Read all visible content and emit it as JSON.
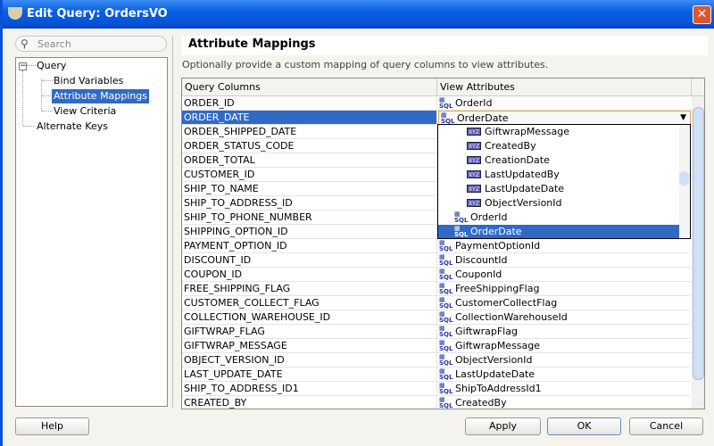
{
  "window": {
    "title": "Edit Query: OrdersVO",
    "close_label": "✕"
  },
  "search": {
    "placeholder": "Search",
    "icon": "search-icon"
  },
  "tree": {
    "items": [
      {
        "label": "Query",
        "expander": "−"
      },
      {
        "label": "Bind Variables"
      },
      {
        "label": "Attribute Mappings",
        "selected": true
      },
      {
        "label": "View Criteria"
      },
      {
        "label": "Alternate Keys"
      }
    ]
  },
  "panel": {
    "title": "Attribute Mappings",
    "description": "Optionally provide a custom mapping of query columns to view attributes."
  },
  "table": {
    "headers": [
      "Query Columns",
      "View Attributes"
    ],
    "rows": [
      [
        "ORDER_ID",
        "OrderId"
      ],
      [
        "ORDER_DATE",
        "OrderDate"
      ],
      [
        "ORDER_SHIPPED_DATE",
        ""
      ],
      [
        "ORDER_STATUS_CODE",
        ""
      ],
      [
        "ORDER_TOTAL",
        ""
      ],
      [
        "CUSTOMER_ID",
        ""
      ],
      [
        "SHIP_TO_NAME",
        ""
      ],
      [
        "SHIP_TO_ADDRESS_ID",
        ""
      ],
      [
        "SHIP_TO_PHONE_NUMBER",
        ""
      ],
      [
        "SHIPPING_OPTION_ID",
        ""
      ],
      [
        "PAYMENT_OPTION_ID",
        "PaymentOptionId"
      ],
      [
        "DISCOUNT_ID",
        "DiscountId"
      ],
      [
        "COUPON_ID",
        "CouponId"
      ],
      [
        "FREE_SHIPPING_FLAG",
        "FreeShippingFlag"
      ],
      [
        "CUSTOMER_COLLECT_FLAG",
        "CustomerCollectFlag"
      ],
      [
        "COLLECTION_WAREHOUSE_ID",
        "CollectionWarehouseId"
      ],
      [
        "GIFTWRAP_FLAG",
        "GiftwrapFlag"
      ],
      [
        "GIFTWRAP_MESSAGE",
        "GiftwrapMessage"
      ],
      [
        "OBJECT_VERSION_ID",
        "ObjectVersionId"
      ],
      [
        "LAST_UPDATE_DATE",
        "LastUpdateDate"
      ],
      [
        "SHIP_TO_ADDRESS_ID1",
        "ShipToAddressId1"
      ],
      [
        "CREATED_BY",
        "CreatedBy"
      ]
    ]
  },
  "dropdown": {
    "value": "OrderDate",
    "options": [
      {
        "label": "GiftwrapMessage",
        "icon": "xyz"
      },
      {
        "label": "CreatedBy",
        "icon": "xyz"
      },
      {
        "label": "CreationDate",
        "icon": "xyz"
      },
      {
        "label": "LastUpdatedBy",
        "icon": "xyz"
      },
      {
        "label": "LastUpdateDate",
        "icon": "xyz"
      },
      {
        "label": "ObjectVersionId",
        "icon": "xyz"
      },
      {
        "label": "OrderId",
        "icon": "sql"
      },
      {
        "label": "OrderDate",
        "icon": "sql",
        "selected": true
      }
    ]
  },
  "buttons": {
    "help": "Help",
    "apply": "Apply",
    "ok": "OK",
    "cancel": "Cancel"
  },
  "colors": {
    "selection": "#316ac5",
    "titlebar": "#0a5fe0"
  }
}
